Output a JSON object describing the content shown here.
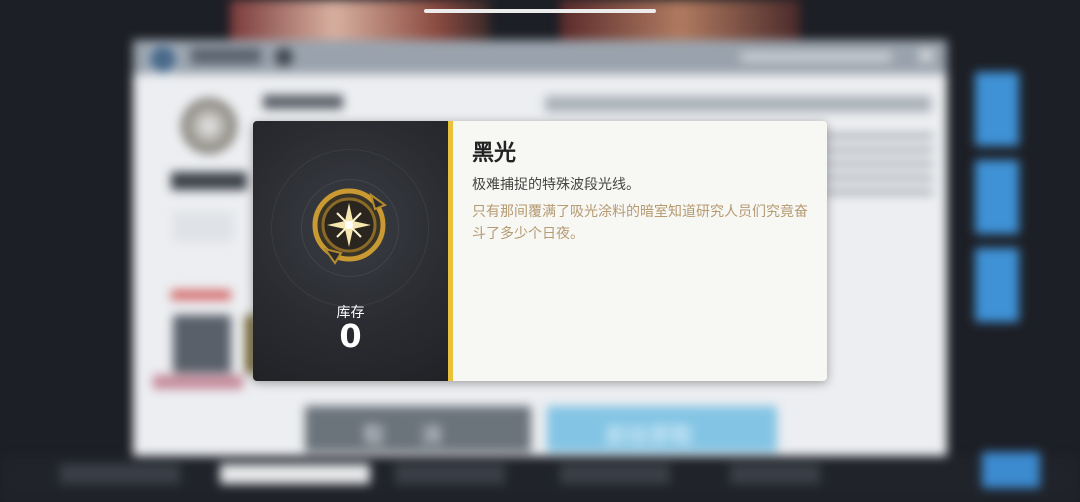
{
  "item_tooltip": {
    "name": "黑光",
    "description": "极难捕捉的特殊波段光线。",
    "flavor_text": "只有那间覆满了吸光涂料的暗室知道研究人员们究竟奋斗了多少个日夜。",
    "stock_label": "库存",
    "stock_value": "0",
    "icon": "black-light-emblem-icon"
  },
  "background_dialog": {
    "cancel_label": "取 消",
    "go_obtain_label": "前往获取",
    "close_icon": "close-icon"
  },
  "colors": {
    "accent_gold": "#e8c23a",
    "flavor_text": "#b59a72",
    "tooltip_bg": "#f7f7f4",
    "icon_panel_bg": "#2a2c31",
    "go_button": "#83c4e4",
    "cancel_button": "#6b737b",
    "side_button_blue": "#3f92d6"
  }
}
